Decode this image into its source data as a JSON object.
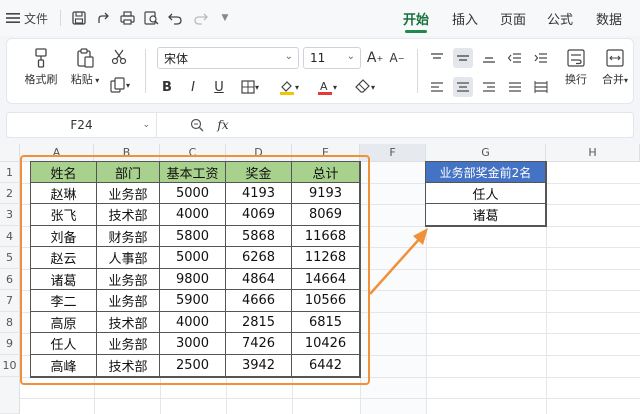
{
  "menubar": {
    "file_label": "文件",
    "tabs": [
      "开始",
      "插入",
      "页面",
      "公式",
      "数据"
    ],
    "active_tab": 0
  },
  "ribbon": {
    "format_painter": "格式刷",
    "paste": "粘贴",
    "font_name": "宋体",
    "font_size": "11",
    "wrap_text": "换行",
    "merge": "合并"
  },
  "formula_bar": {
    "name_box": "F24",
    "fx_label": "fx",
    "formula": ""
  },
  "columns": [
    "A",
    "B",
    "C",
    "D",
    "E",
    "F",
    "G",
    "H"
  ],
  "rows": [
    "1",
    "2",
    "3",
    "4",
    "5",
    "6",
    "7",
    "8",
    "9",
    "10"
  ],
  "table": {
    "headers": [
      "姓名",
      "部门",
      "基本工资",
      "奖金",
      "总计"
    ],
    "rows": [
      [
        "赵琳",
        "业务部",
        "5000",
        "4193",
        "9193"
      ],
      [
        "张飞",
        "技术部",
        "4000",
        "4069",
        "8069"
      ],
      [
        "刘备",
        "财务部",
        "5800",
        "5868",
        "11668"
      ],
      [
        "赵云",
        "人事部",
        "5000",
        "6268",
        "11268"
      ],
      [
        "诸葛",
        "业务部",
        "9800",
        "4864",
        "14664"
      ],
      [
        "李二",
        "业务部",
        "5900",
        "4666",
        "10566"
      ],
      [
        "高原",
        "技术部",
        "4000",
        "2815",
        "6815"
      ],
      [
        "任人",
        "业务部",
        "3000",
        "7426",
        "10426"
      ],
      [
        "高峰",
        "技术部",
        "2500",
        "3942",
        "6442"
      ]
    ]
  },
  "result": {
    "header": "业务部奖金前2名",
    "values": [
      "任人",
      "诸葛"
    ]
  },
  "colors": {
    "accent": "#1f8a4c",
    "table_header": "#a9d18e",
    "result_header": "#4472c4",
    "highlight": "#f0913a"
  }
}
